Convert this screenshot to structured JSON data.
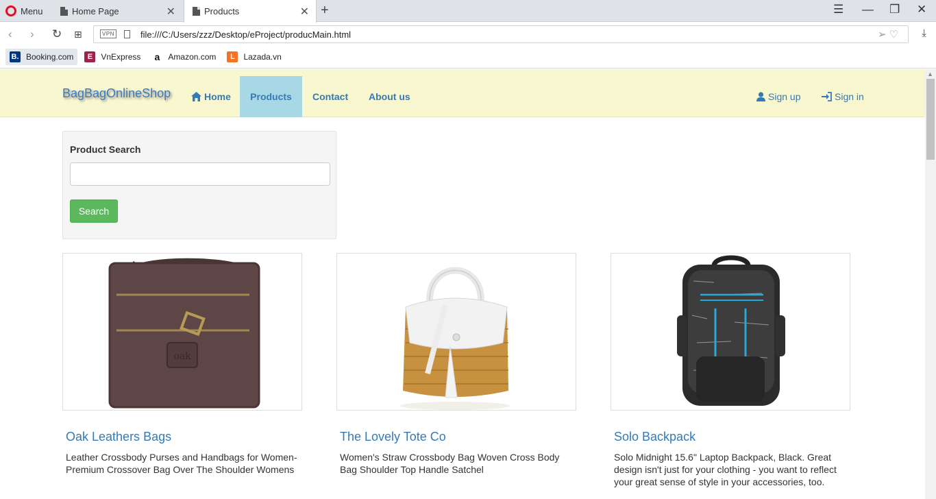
{
  "browser": {
    "menu_label": "Menu",
    "tabs": [
      {
        "title": "Home Page"
      },
      {
        "title": "Products"
      }
    ],
    "url": "file:///C:/Users/zzz/Desktop/eProject/producMain.html",
    "vpn_label": "VPN",
    "bookmarks": [
      {
        "label": "Booking.com",
        "fav_text": "B.",
        "fav_color": "#003580"
      },
      {
        "label": "VnExpress",
        "fav_text": "E",
        "fav_color": "#9f224e"
      },
      {
        "label": "Amazon.com",
        "fav_text": "a",
        "fav_color": "#ffffff"
      },
      {
        "label": "Lazada.vn",
        "fav_text": "L",
        "fav_color": "#f57224"
      }
    ]
  },
  "site": {
    "brand": "BagBagOnlineShop",
    "nav": [
      {
        "label": "Home",
        "icon": "home-icon"
      },
      {
        "label": "Products"
      },
      {
        "label": "Contact"
      },
      {
        "label": "About us"
      }
    ],
    "auth": [
      {
        "label": "Sign up",
        "icon": "user-icon"
      },
      {
        "label": "Sign in",
        "icon": "sign-in-icon"
      }
    ],
    "search": {
      "label": "Product Search",
      "placeholder": "",
      "button": "Search"
    },
    "products": [
      {
        "title": "Oak Leathers Bags",
        "desc": "Leather Crossbody Purses and Handbags for Women- Premium Crossover Bag Over The Shoulder Womens"
      },
      {
        "title": "The Lovely Tote Co",
        "desc": "Women's Straw Crossbody Bag Woven Cross Body Bag Shoulder Top Handle Satchel"
      },
      {
        "title": "Solo Backpack",
        "desc": "Solo Midnight 15.6\" Laptop Backpack, Black. Great design isn't just for your clothing - you want to reflect your great sense of style in your accessories, too."
      }
    ]
  },
  "colors": {
    "navbar_bg": "#f8f7cf",
    "link": "#337ab7",
    "active_nav": "#a8d8e6",
    "search_button": "#5cb85c"
  }
}
